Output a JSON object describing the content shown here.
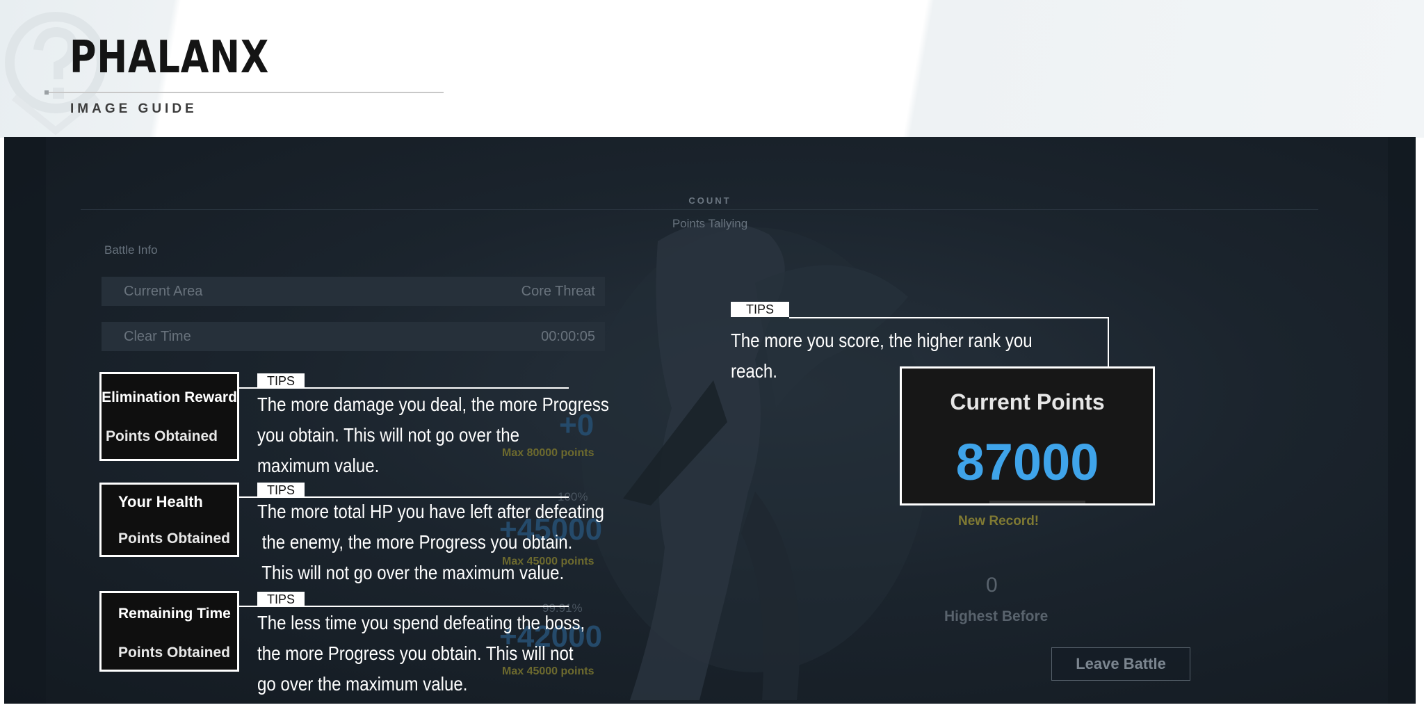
{
  "header": {
    "brand": "PHALANX",
    "subtitle": "IMAGE GUIDE"
  },
  "game": {
    "count_label": "COUNT",
    "points_tallying": "Points Tallying",
    "battle_info": "Battle Info",
    "info_rows": [
      {
        "key": "Current Area",
        "value": "Core Threat"
      },
      {
        "key": "Clear Time",
        "value": "00:00:05"
      }
    ],
    "background_values": {
      "elimination_value": "+0",
      "elimination_max": "Max 80000 points",
      "health_pct": "100%",
      "health_value": "+45000",
      "health_max": "Max 45000 points",
      "time_pct": "99.91%",
      "time_value": "+42000",
      "time_max": "Max 45000 points"
    },
    "new_record": "New Record!",
    "highest_before_value": "0",
    "highest_before_label": "Highest Before",
    "leave_button": "Leave Battle"
  },
  "current_points": {
    "title": "Current Points",
    "value": "87000"
  },
  "callouts": [
    {
      "title": "Elimination Reward",
      "subtitle": "Points Obtained",
      "tag": "TIPS",
      "lines": [
        "The more damage you deal, the more Progress",
        "you obtain. This will not go over the",
        "maximum value."
      ]
    },
    {
      "title": "Your Health",
      "subtitle": "Points Obtained",
      "tag": "TIPS",
      "lines": [
        "The more total HP you have left after defeating",
        " the enemy, the more Progress you obtain.",
        " This will not go over the maximum value."
      ]
    },
    {
      "title": "Remaining Time",
      "subtitle": "Points Obtained",
      "tag": "TIPS",
      "lines": [
        "The less time you spend defeating the boss,",
        "the more Progress you obtain. This will not",
        "go over the maximum value."
      ]
    }
  ],
  "rank_tip": {
    "tag": "TIPS",
    "lines": [
      "The more you score, the higher rank you",
      "reach."
    ]
  },
  "colors": {
    "points_blue": "#3fa4ea",
    "panel_dark": "#1b242d",
    "record_yellow": "#807a33"
  }
}
